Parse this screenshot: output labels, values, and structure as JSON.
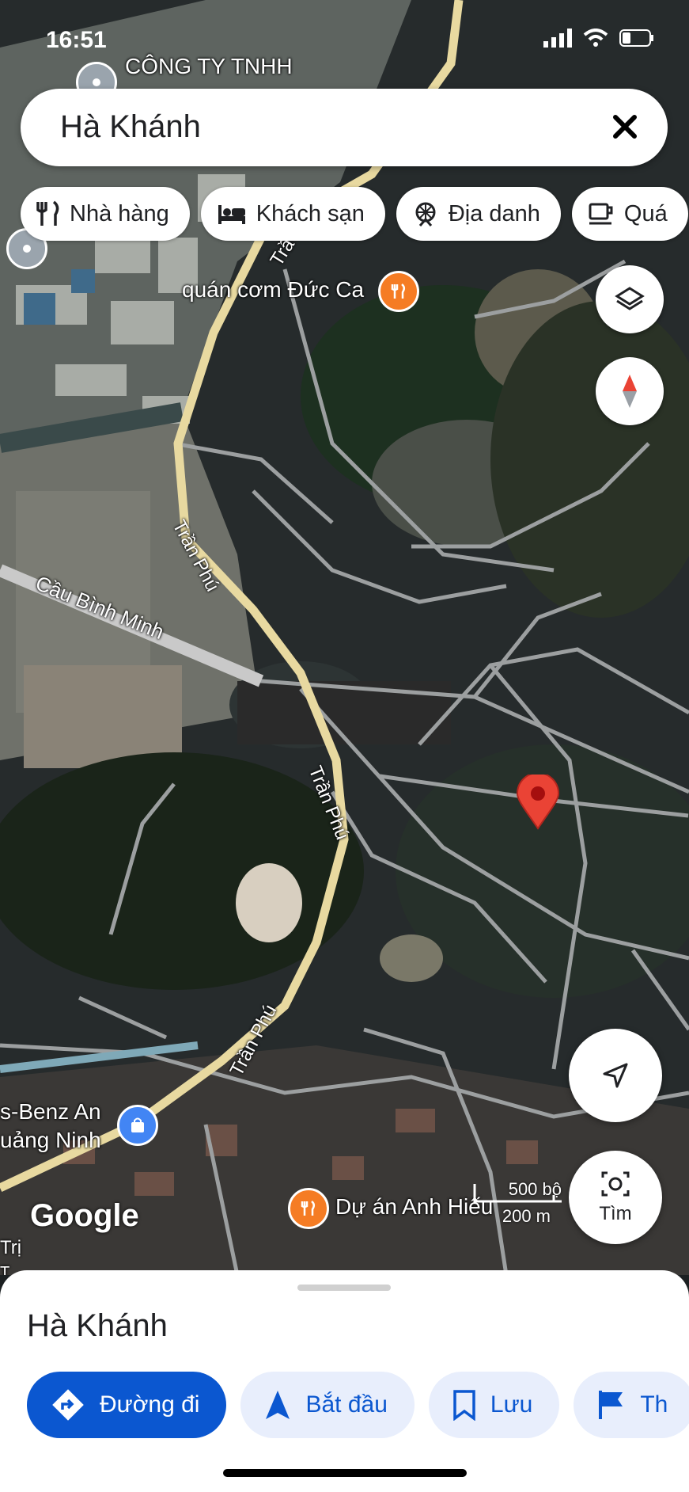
{
  "status_bar": {
    "time": "16:51"
  },
  "search": {
    "query": "Hà Khánh"
  },
  "chips": [
    {
      "label": "Nhà hàng",
      "icon": "restaurant-icon"
    },
    {
      "label": "Khách sạn",
      "icon": "hotel-icon"
    },
    {
      "label": "Địa danh",
      "icon": "attraction-icon"
    },
    {
      "label": "Quá",
      "icon": "cafe-icon"
    }
  ],
  "map_labels": {
    "company": "CÔNG TY TNHH",
    "restaurant": "quán cơm Đức Ca",
    "bridge": "Cầu Bình Minh",
    "road1": "Trần Phú",
    "road2": "Trần Phú",
    "road3": "Trần Phú",
    "road_top": "Trầ",
    "dealer_line1": "s-Benz An",
    "dealer_line2": "uảng Ninh",
    "project": "Dự án Anh Hiếu",
    "edge1": "Trị",
    "edge2": "T"
  },
  "map": {
    "attribution": "Google",
    "scale_imperial": "500 bộ",
    "scale_metric": "200 m",
    "lens_label": "Tìm",
    "colors": {
      "road": "#e8d9a0",
      "pin": "#ea4335",
      "poi_food": "#f57c24",
      "poi_shop": "#4285f4"
    }
  },
  "sheet": {
    "title": "Hà Khánh",
    "actions": [
      {
        "label": "Đường đi"
      },
      {
        "label": "Bắt đầu"
      },
      {
        "label": "Lưu"
      },
      {
        "label": "Th"
      }
    ]
  }
}
